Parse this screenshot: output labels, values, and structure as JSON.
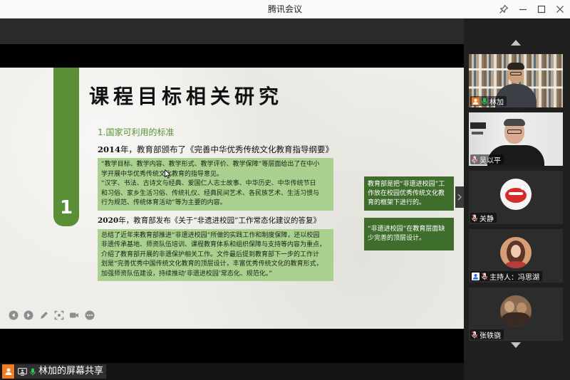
{
  "window": {
    "title": "腾讯会议",
    "controls": {
      "pin_icon": "pin-icon",
      "minimize_icon": "minimize-icon",
      "maximize_icon": "maximize-icon",
      "close_icon": "close-icon"
    }
  },
  "slide": {
    "section_number": "1",
    "title": "课程目标相关研究",
    "subheading": "1.国家可利用的标准",
    "items": [
      {
        "year": "2014",
        "heading": "年，教育部颁布了《完善中华优秀传统文化教育指导纲要》",
        "box_lines": [
          "“教学目标、教学内容、教学形式、教学评价、教学保障”等层面给出了在中小",
          "学开展中华优秀传统文化教育的指导意见。",
          "“汉字、书法、古诗文与经典、爱国仁人志士故事、中华历史、中华传统节日",
          "和习俗、家乡生活习俗、传统礼仪、经典民间艺术、各民族艺术、生活习惯与",
          "行为规范、传统体育活动”等为主要的内容。"
        ]
      },
      {
        "year": "2020",
        "heading": "年，教育部发布《关于“非遗进校园”工作常态化建议的答复》",
        "box_lines": [
          "总结了近年来教育部推进“非遗进校园”所做的实践工作和制度保障，还以校园",
          "非遗传承基地、师资队伍培训、课程教育体系和组织保障与支持等内容为重点，",
          "介绍了教育部开展的非遗保护相关工作。文件最后提到教育部下一步的工作计",
          "划是“完善优秀中国传统文化教育的顶层设计，丰富优秀传统文化的教育形式，",
          "加强师资队伍建设，持续推动‘非遗进校园’常态化、规范化。”"
        ]
      }
    ],
    "callouts": [
      {
        "lines": [
          "教育部是把“非遗进校园”工",
          "作放在校园优秀传统文化教",
          "育的框架下进行的。"
        ]
      },
      {
        "lines": [
          "“非遗进校园”在教育层面缺",
          "少完善的顶层设计。"
        ]
      }
    ],
    "toolbar_icons": [
      "previous-page-icon",
      "next-page-icon",
      "pen-icon",
      "screenshot-icon",
      "video-icon",
      "more-icon"
    ]
  },
  "participants": {
    "scroll_up_icon": "chevron-up-icon",
    "scroll_down_icon": "chevron-down-icon",
    "collapse_icon": "chevron-right-icon",
    "tiles": [
      {
        "name": "林加",
        "active_speaker": true,
        "badge_icon": "self-icon",
        "mic_icon": "mic-active-icon"
      },
      {
        "name": "吴以平",
        "active_speaker": false,
        "mic_icon": "mic-muted-icon"
      },
      {
        "name": "关静",
        "active_speaker": false,
        "mic_icon": "mic-muted-icon"
      },
      {
        "name": "主持人：冯思湖",
        "active_speaker": false,
        "badge_icon": "host-icon",
        "mic_icon": "mic-muted-icon"
      },
      {
        "name": "张轶骁",
        "active_speaker": false,
        "mic_icon": "mic-muted-icon"
      }
    ]
  },
  "status_bar": {
    "share_label": "林加的屏幕共享",
    "icons": [
      "self-icon",
      "screen-share-icon",
      "mic-active-icon"
    ]
  },
  "colors": {
    "slide_green": "#5b8f36",
    "box_light_green": "#a9d08e",
    "callout_dark_green": "#3f6d2b",
    "active_speaker_border": "#2fc25b",
    "self_badge_orange": "#f07c21",
    "mic_active_green": "#2fc25b"
  }
}
